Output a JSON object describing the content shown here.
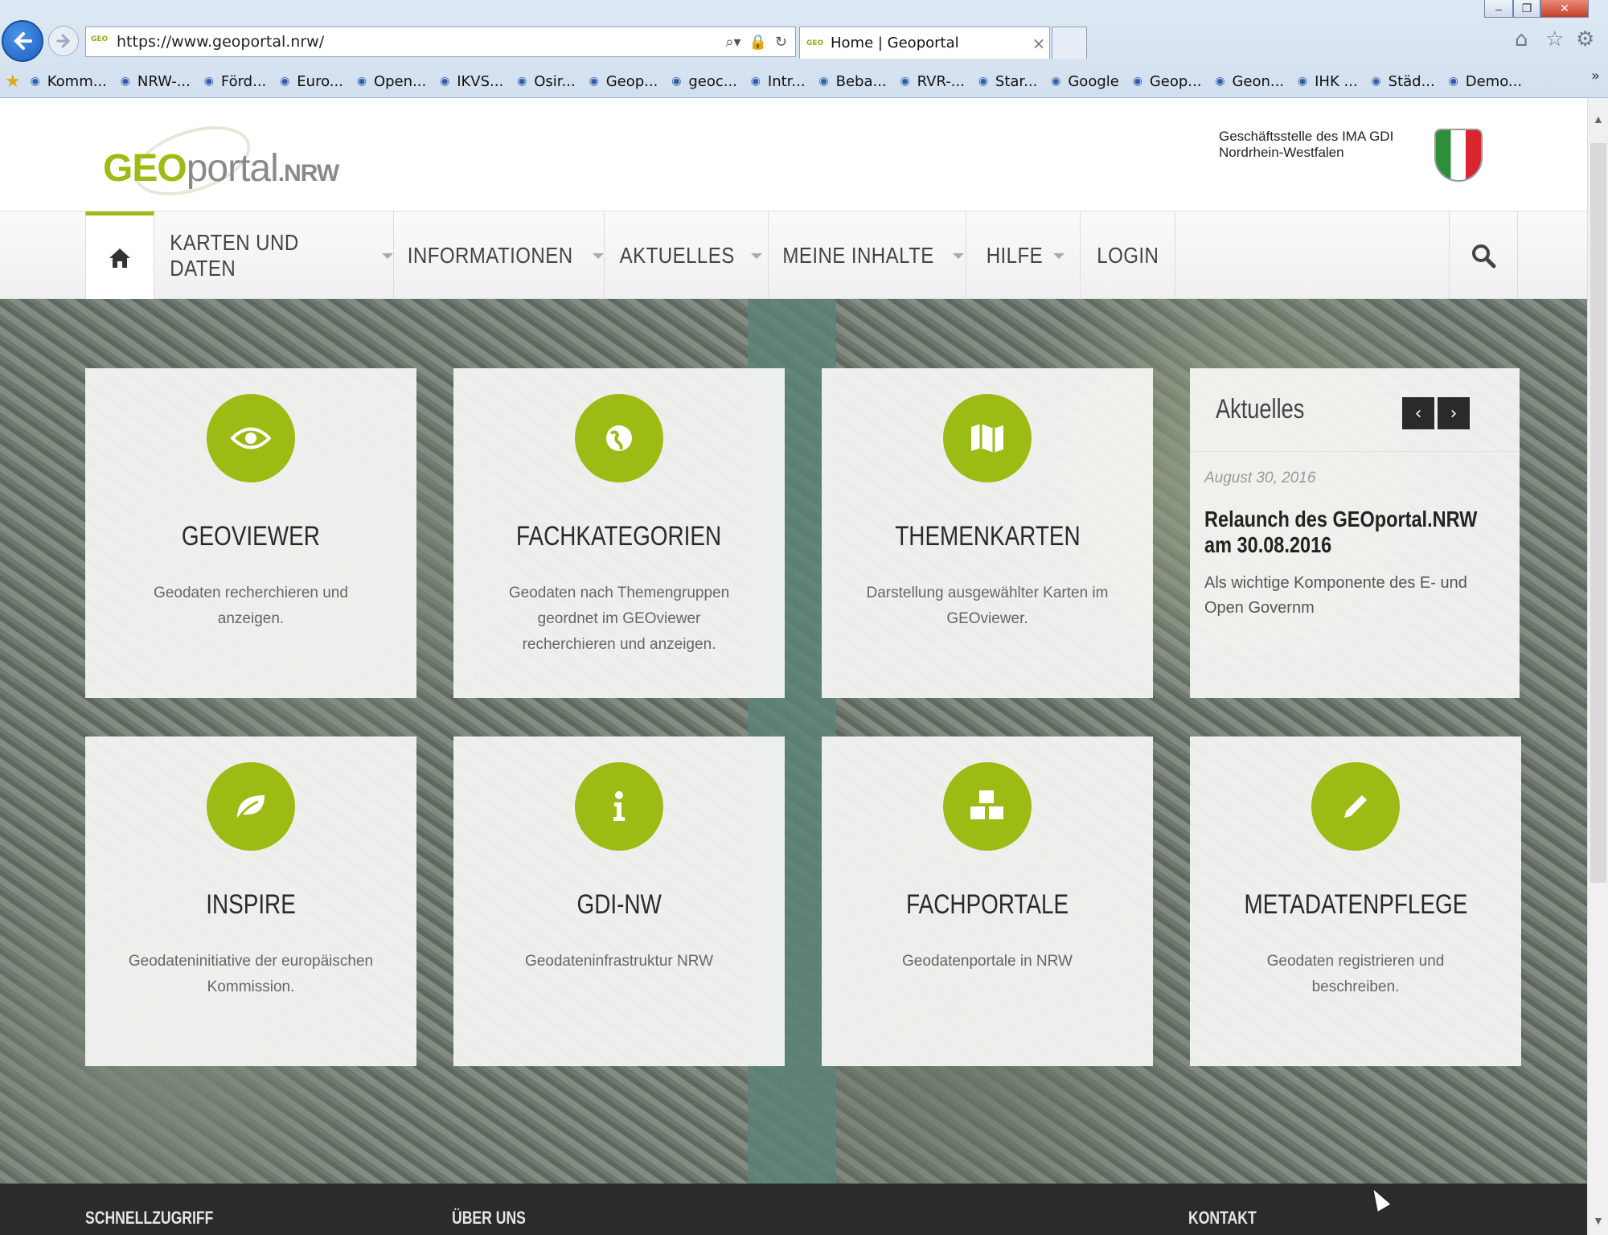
{
  "browser": {
    "url": "https://www.geoportal.nrw/",
    "tab_title": "Home | Geoportal",
    "tab_favicon": "GEO",
    "window_controls": {
      "minimize": "–",
      "maximize": "❐",
      "close": "✕"
    },
    "toolbar_icons": [
      "home-icon",
      "star-icon",
      "gear-icon"
    ],
    "favorites": [
      "Komm...",
      "NRW-...",
      "Förd...",
      "Euro...",
      "Open...",
      "IKVS...",
      "Osir...",
      "Geop...",
      "geoc...",
      "Intr...",
      "Beba...",
      "RVR-...",
      "Star...",
      "Google",
      "Geop...",
      "Geon...",
      "IHK ...",
      "Städ...",
      "Demo..."
    ],
    "favorites_more": "»"
  },
  "header": {
    "logo": {
      "geo": "GEO",
      "portal": "portal",
      "nrw": ".NRW"
    },
    "ministry_line1": "Geschäftsstelle des IMA GDI",
    "ministry_line2": "Nordrhein-Westfalen"
  },
  "nav": {
    "home_icon": "⌂",
    "items": [
      {
        "label": "KARTEN UND DATEN",
        "dropdown": true
      },
      {
        "label": "INFORMATIONEN",
        "dropdown": true
      },
      {
        "label": "AKTUELLES",
        "dropdown": true
      },
      {
        "label": "MEINE INHALTE",
        "dropdown": true
      },
      {
        "label": "HILFE",
        "dropdown": true
      },
      {
        "label": "LOGIN",
        "dropdown": false
      }
    ],
    "search_icon": "⌕"
  },
  "tiles": [
    {
      "icon": "eye-icon",
      "glyph": "👁",
      "title": "GEOVIEWER",
      "desc": "Geodaten recherchieren und anzeigen."
    },
    {
      "icon": "globe-icon",
      "glyph": "🌍",
      "title": "FACHKATEGORIEN",
      "desc": "Geodaten nach Themengruppen geordnet im GEOviewer recherchieren und anzeigen."
    },
    {
      "icon": "map-icon",
      "glyph": "🗺",
      "title": "THEMENKARTEN",
      "desc": "Darstellung ausgewählter Karten im GEOviewer."
    },
    {
      "icon": "leaf-icon",
      "glyph": "🍃",
      "title": "INSPIRE",
      "desc": "Geodateninitiative der europäischen Kommission."
    },
    {
      "icon": "info-icon",
      "glyph": "i",
      "title": "GDI-NW",
      "desc": "Geodateninfrastruktur NRW"
    },
    {
      "icon": "cubes-icon",
      "glyph": "⬢",
      "title": "FACHPORTALE",
      "desc": "Geodatenportale in NRW"
    },
    {
      "icon": "pencil-icon",
      "glyph": "✎",
      "title": "METADATENPFLEGE",
      "desc": "Geodaten registrieren und beschreiben."
    }
  ],
  "news": {
    "heading": "Aktuelles",
    "prev": "‹",
    "next": "›",
    "date": "August 30, 2016",
    "title": "Relaunch des GEOportal.NRW am 30.08.2016",
    "teaser": "Als wichtige Komponente des E- und Open Governm"
  },
  "footer": {
    "col1": "SCHNELLZUGRIFF",
    "col2": "ÜBER UNS",
    "col3": "KONTAKT"
  },
  "colors": {
    "accent": "#9dbb15",
    "footer_bg": "#2b2b2b"
  }
}
